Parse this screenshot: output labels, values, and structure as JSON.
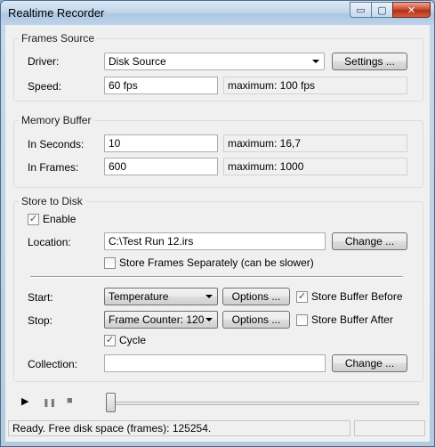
{
  "window": {
    "title": "Realtime Recorder",
    "controls": {
      "minimize": "▭",
      "maximize": "▢",
      "close": "✕"
    }
  },
  "frames_source": {
    "title": "Frames Source",
    "driver_label": "Driver:",
    "driver_value": "Disk Source",
    "settings_button": "Settings ...",
    "speed_label": "Speed:",
    "speed_value": "60 fps",
    "speed_max": "maximum: 100 fps"
  },
  "memory_buffer": {
    "title": "Memory Buffer",
    "seconds_label": "In Seconds:",
    "seconds_value": "10",
    "seconds_max": "maximum: 16,7",
    "frames_label": "In Frames:",
    "frames_value": "600",
    "frames_max": "maximum: 1000"
  },
  "store_to_disk": {
    "title": "Store to Disk",
    "enable_label": "Enable",
    "enable_checked": true,
    "location_label": "Location:",
    "location_value": "C:\\Test Run 12.irs",
    "location_change": "Change ...",
    "separate_label": "Store Frames Separately (can be slower)",
    "separate_checked": false,
    "start_label": "Start:",
    "start_value": "Temperature",
    "start_options": "Options ...",
    "buffer_before_label": "Store Buffer Before",
    "buffer_before_checked": true,
    "stop_label": "Stop:",
    "stop_value": "Frame Counter: 120",
    "stop_options": "Options ...",
    "buffer_after_label": "Store Buffer After",
    "buffer_after_checked": false,
    "cycle_label": "Cycle",
    "cycle_checked": true,
    "collection_label": "Collection:",
    "collection_value": "",
    "collection_change": "Change ..."
  },
  "transport": {
    "play_glyph": "▶",
    "pause_glyph": "❚❚",
    "stop_glyph": "■",
    "position": 0
  },
  "status": {
    "text": "Ready. Free disk space (frames): 125254."
  }
}
